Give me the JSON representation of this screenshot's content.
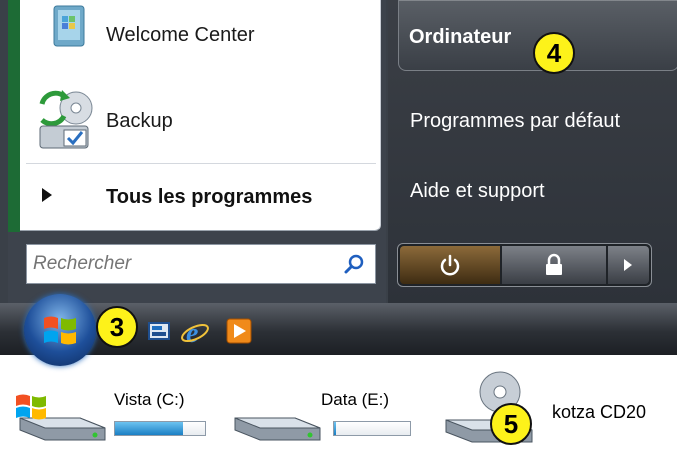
{
  "start_menu": {
    "programs": [
      {
        "label": "Welcome Center",
        "icon": "welcome-center-icon"
      },
      {
        "label": "Backup",
        "icon": "backup-icon"
      }
    ],
    "all_programs_label": "Tous les programmes",
    "search": {
      "placeholder": "Rechercher"
    },
    "right_items": {
      "computer": "Ordinateur",
      "default_programs": "Programmes par défaut",
      "help": "Aide et support"
    },
    "power_buttons": [
      "power-icon",
      "lock-icon",
      "arrow-right-icon"
    ]
  },
  "taskbar": {
    "quick_launch_icons": [
      "show-desktop-icon",
      "internet-explorer-icon",
      "media-player-icon"
    ]
  },
  "drives": [
    {
      "label": "Vista (C:)",
      "usage": 0.75,
      "icon": "windows-drive-icon"
    },
    {
      "label": "Data (E:)",
      "usage": 0.03,
      "icon": "hard-drive-icon"
    },
    {
      "label": "kotza CD20",
      "icon": "cd-drive-icon"
    }
  ],
  "badges": {
    "orb": "3",
    "computer": "4",
    "cd": "5"
  },
  "colors": {
    "badge": "#fdf21a",
    "accent_green": "#1d6b35",
    "usage_blue": "#1a7fc4"
  }
}
